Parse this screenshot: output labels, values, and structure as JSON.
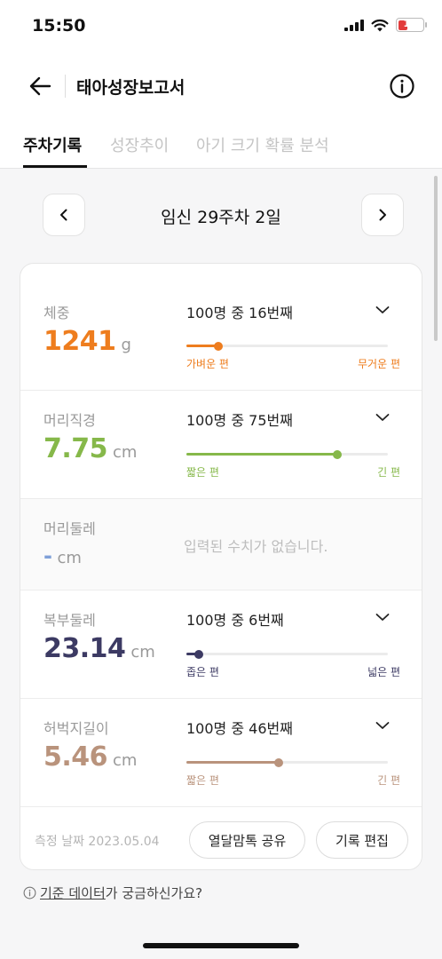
{
  "status": {
    "time": "15:50",
    "battery": "11"
  },
  "header": {
    "title": "태아성장보고서"
  },
  "tabs": [
    {
      "label": "주차기록",
      "active": true
    },
    {
      "label": "성장추이",
      "active": false
    },
    {
      "label": "아기 크기 확률 분석",
      "active": false
    }
  ],
  "date": {
    "label": "임신 29주차 2일"
  },
  "measurements": [
    {
      "label": "체중",
      "value": "1241",
      "unit": "g",
      "rank": "100명 중 16번째",
      "percentile": 16,
      "min_label": "가벼운 편",
      "max_label": "무거운 편",
      "color": "#ee7d1e"
    },
    {
      "label": "머리직경",
      "value": "7.75",
      "unit": "cm",
      "rank": "100명 중 75번째",
      "percentile": 75,
      "min_label": "짧은 편",
      "max_label": "긴 편",
      "color": "#86b84a"
    },
    {
      "label": "머리둘레",
      "value": "-",
      "unit": "cm",
      "empty_message": "입력된 수치가 없습니다.",
      "color": "#7fa0d8"
    },
    {
      "label": "복부둘레",
      "value": "23.14",
      "unit": "cm",
      "rank": "100명 중 6번째",
      "percentile": 6,
      "min_label": "좁은 편",
      "max_label": "넓은 편",
      "color": "#3c3a63"
    },
    {
      "label": "허벅지길이",
      "value": "5.46",
      "unit": "cm",
      "rank": "100명 중 46번째",
      "percentile": 46,
      "min_label": "짧은 편",
      "max_label": "긴 편",
      "color": "#b9937c"
    }
  ],
  "footer": {
    "measure_date": "측정 날짜 2023.05.04",
    "share_label": "열달맘톡 공유",
    "edit_label": "기록 편집"
  },
  "help": {
    "link": "기준 데이터",
    "suffix": "가 궁금하신가요?"
  },
  "icons": {
    "back": "arrow-left-icon",
    "info": "info-circle-icon",
    "prev": "chevron-left-icon",
    "next": "chevron-right-icon",
    "expand": "chevron-down-icon"
  }
}
